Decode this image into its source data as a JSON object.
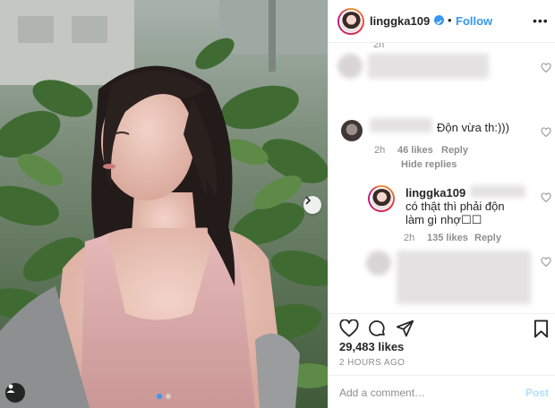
{
  "header": {
    "username": "lingg​ka109",
    "follow_label": "Follow",
    "separator": "•",
    "more_label": "•••"
  },
  "comments": {
    "top": {
      "time": "2h"
    },
    "first": {
      "text_visible": "Độn vừa th:)))",
      "time": "2h",
      "likes": "46 likes",
      "reply_label": "Reply",
      "hide_replies_label": "Hide replies"
    },
    "reply": {
      "username": "linggka109",
      "text": "có thật thì phải độn làm gì nhợ☐☐",
      "time": "2h",
      "likes": "135 likes",
      "reply_label": "Reply"
    }
  },
  "actions": {
    "likes": "29,483 likes",
    "time": "2 HOURS AGO"
  },
  "add_comment": {
    "placeholder": "Add a comment…",
    "post_label": "Post"
  },
  "carousel": {
    "total": 2,
    "active_index": 1
  },
  "icons": {
    "verified": "verified-badge-icon",
    "more": "more-options-icon",
    "heart": "heart-icon",
    "comment": "comment-icon",
    "share": "share-icon",
    "save": "bookmark-icon",
    "next": "chevron-right-icon",
    "tag": "user-tag-icon"
  },
  "colors": {
    "accent": "#3897f0",
    "post_disabled": "#b2dffc",
    "muted": "#8e8e8e"
  }
}
